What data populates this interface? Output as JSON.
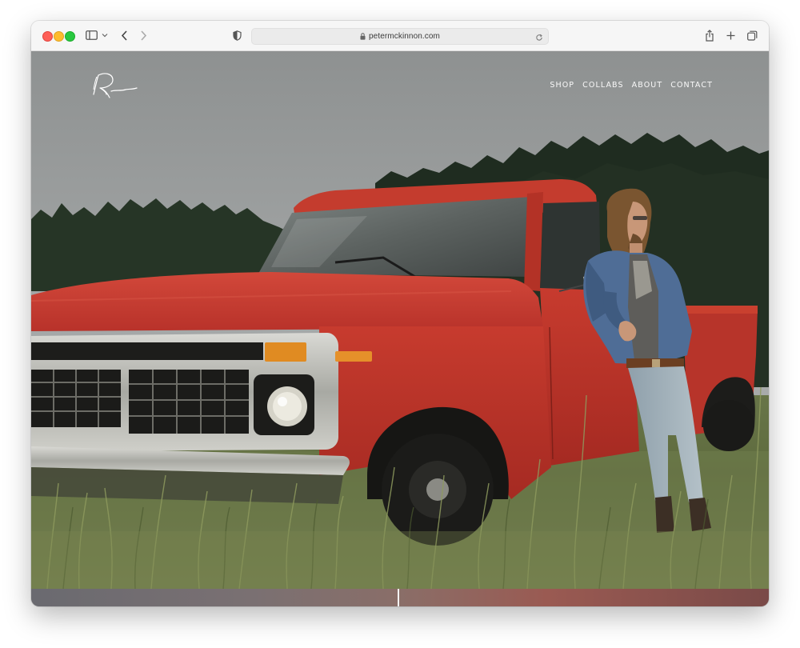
{
  "browser": {
    "url": "petermckinnon.com",
    "icons": [
      "sidebar-icon",
      "chevron-down-icon",
      "back-icon",
      "forward-icon",
      "shield-icon",
      "lock-icon",
      "reload-icon",
      "share-icon",
      "new-tab-icon",
      "tabs-overview-icon"
    ]
  },
  "site": {
    "logo_alt": "Peter McKinnon signature logo",
    "nav": {
      "shop": "SHOP",
      "collabs": "COLLABS",
      "about": "ABOUT",
      "contact": "CONTACT"
    }
  },
  "colors": {
    "truck_red": "#c8392c",
    "sky_gray": "#9a9d9e",
    "grass_green": "#5d6b3c",
    "traffic_close": "#fe5f57",
    "traffic_min": "#febc2e",
    "traffic_max": "#28c840"
  }
}
